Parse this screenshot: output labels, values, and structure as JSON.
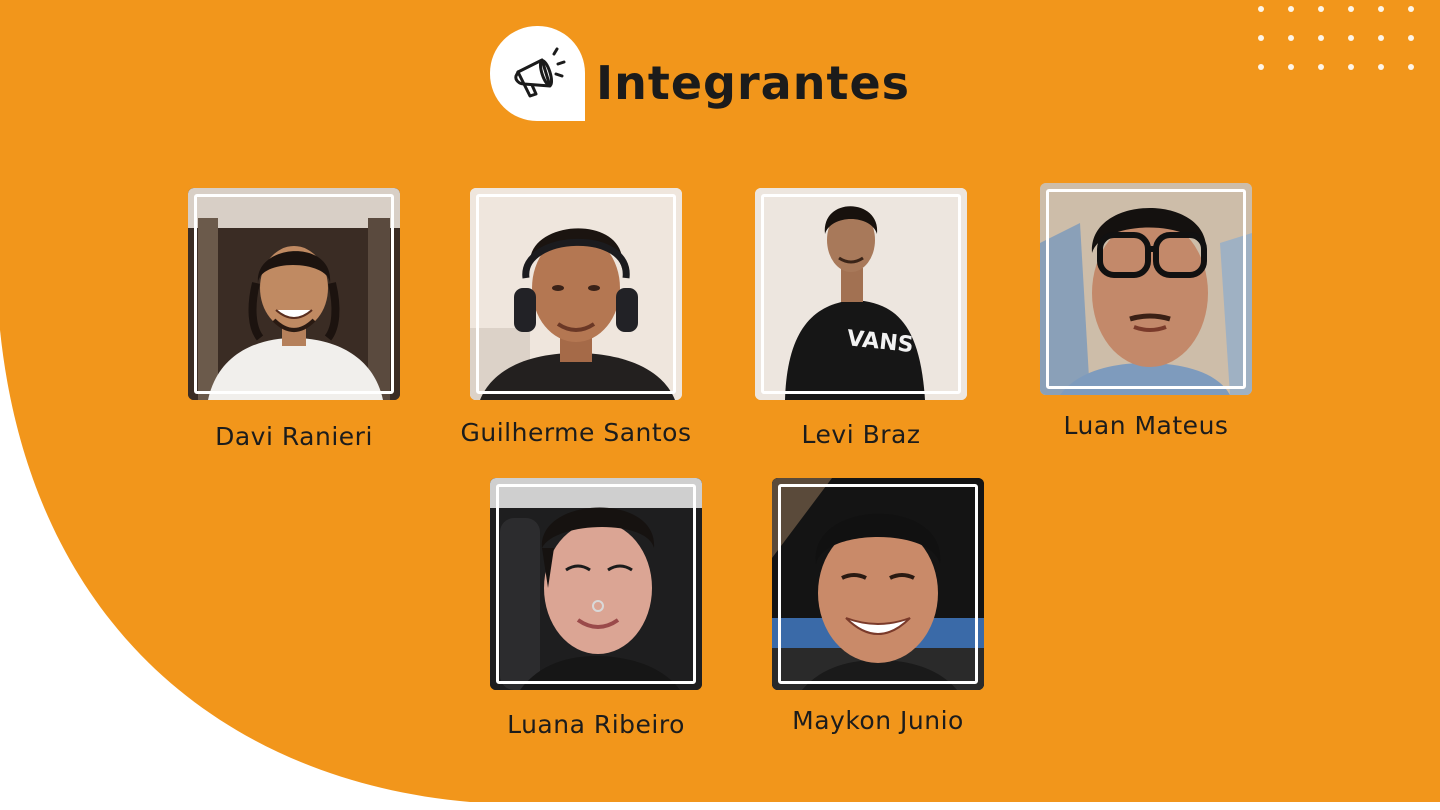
{
  "slide": {
    "title": "Integrantes",
    "title_icon": "megaphone-icon",
    "colors": {
      "accent": "#F2961B",
      "background": "#FFFFFF",
      "text": "#1B1B1B"
    }
  },
  "members": [
    {
      "name": "Davi Ranieri"
    },
    {
      "name": "Guilherme Santos"
    },
    {
      "name": "Levi Braz"
    },
    {
      "name": "Luan Mateus"
    },
    {
      "name": "Luana Ribeiro"
    },
    {
      "name": "Maykon Junio"
    }
  ]
}
